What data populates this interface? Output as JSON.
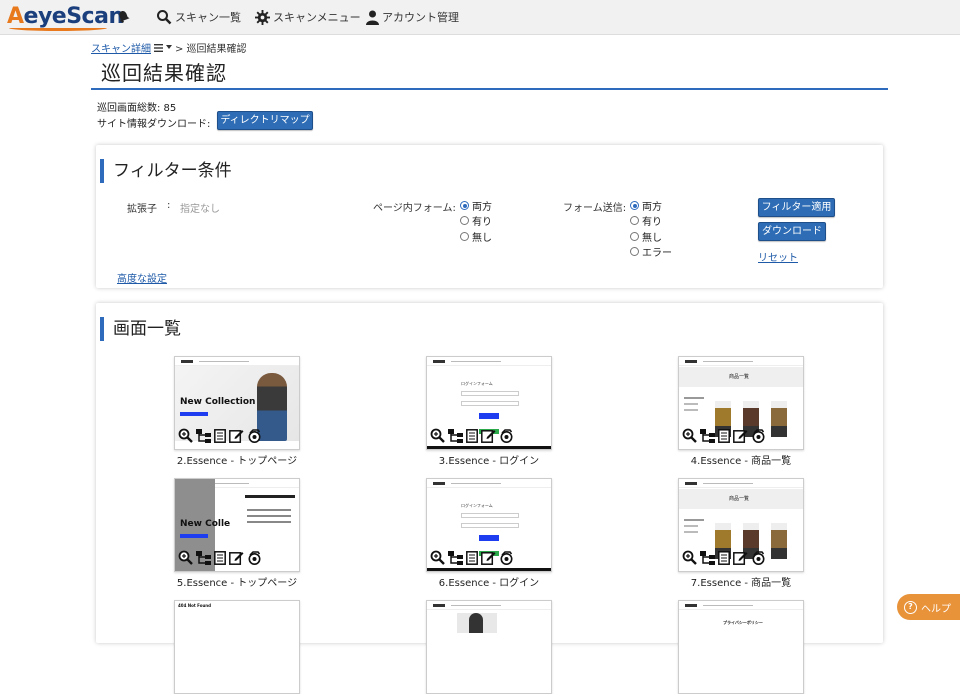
{
  "app": {
    "brand_a": "A",
    "brand_rest": "eyeScan"
  },
  "nav": {
    "scan_list": "スキャン一覧",
    "scan_menu": "スキャンメニュー",
    "account": "アカウント管理"
  },
  "breadcrumb": {
    "link": "スキャン詳細",
    "sep": "> 巡回結果確認"
  },
  "page": {
    "title": "巡回結果確認"
  },
  "summary": {
    "total_screens": "巡回画面総数: 85",
    "download_label": "サイト情報ダウンロード:",
    "directory_map_button": "ディレクトリマップ"
  },
  "filter": {
    "title": "フィルター条件",
    "extension_label": "拡張子",
    "extension_colon": ":",
    "extension_value": "指定なし",
    "form_label": "ページ内フォーム:",
    "form_options": [
      "両方",
      "有り",
      "無し"
    ],
    "form_selected": "両方",
    "submit_label": "フォーム送信:",
    "submit_options": [
      "両方",
      "有り",
      "無し",
      "エラー"
    ],
    "submit_selected": "両方",
    "apply_button": "フィルター適用",
    "download_button": "ダウンロード",
    "reset_link": "リセット",
    "advanced_link": "高度な設定"
  },
  "screens": {
    "title": "画面一覧",
    "items": [
      {
        "caption": "2.Essence - トップページ",
        "thumb_text": "New Collection"
      },
      {
        "caption": "3.Essence - ログイン",
        "thumb_text": "ログインフォーム"
      },
      {
        "caption": "4.Essence - 商品一覧",
        "thumb_text": "商品一覧"
      },
      {
        "caption": "5.Essence - トップページ",
        "thumb_text": "New Colle"
      },
      {
        "caption": "6.Essence - ログイン",
        "thumb_text": "ログインフォーム"
      },
      {
        "caption": "7.Essence - 商品一覧",
        "thumb_text": "商品一覧"
      }
    ],
    "partial_row": [
      {
        "thumb_text": "404 Not Found"
      },
      {
        "thumb_text": ""
      },
      {
        "thumb_text": "プライバシーポリシー"
      }
    ]
  },
  "help": {
    "label": "ヘルプ"
  },
  "colors": {
    "accent": "#2f6bbd",
    "button": "#2e6db5",
    "brand_orange": "#e8791c",
    "help": "#e8923a"
  }
}
